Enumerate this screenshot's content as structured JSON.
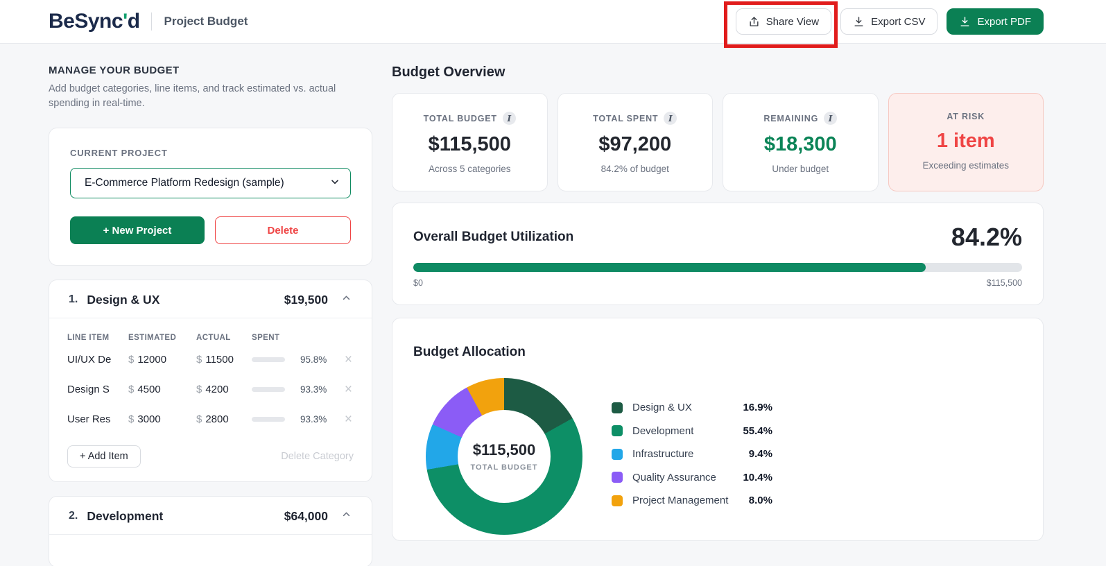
{
  "header": {
    "logo": {
      "pre": "BeSync",
      "apostrophe": "'",
      "post": "d"
    },
    "page_title": "Project Budget",
    "buttons": {
      "share": "Share View",
      "export_csv": "Export CSV",
      "export_pdf": "Export PDF"
    }
  },
  "sidebar": {
    "heading": "MANAGE YOUR BUDGET",
    "description": "Add budget categories, line items, and track estimated vs. actual spending in real-time.",
    "project": {
      "label": "CURRENT PROJECT",
      "selected": "E-Commerce Platform Redesign (sample)",
      "new_button": "+ New Project",
      "delete_button": "Delete"
    },
    "table_columns": {
      "line_item": "LINE ITEM",
      "estimated": "ESTIMATED",
      "actual": "ACTUAL",
      "spent": "SPENT"
    },
    "categories": [
      {
        "number": "1.",
        "name": "Design & UX",
        "total": "$19,500",
        "items": [
          {
            "name": "UI/UX De",
            "currency": "$",
            "estimated": "12000",
            "actual": "11500",
            "spent": "95.8%"
          },
          {
            "name": "Design S",
            "currency": "$",
            "estimated": "4500",
            "actual": "4200",
            "spent": "93.3%"
          },
          {
            "name": "User Res",
            "currency": "$",
            "estimated": "3000",
            "actual": "2800",
            "spent": "93.3%"
          }
        ],
        "add_item": "+ Add Item",
        "delete_category": "Delete Category",
        "close_glyph": "×"
      },
      {
        "number": "2.",
        "name": "Development",
        "total": "$64,000"
      }
    ]
  },
  "overview": {
    "title": "Budget Overview",
    "info_glyph": "I",
    "cards": [
      {
        "label": "TOTAL BUDGET",
        "value": "$115,500",
        "sub": "Across 5 categories"
      },
      {
        "label": "TOTAL SPENT",
        "value": "$97,200",
        "sub": "84.2% of budget"
      },
      {
        "label": "REMAINING",
        "value": "$18,300",
        "sub": "Under budget"
      },
      {
        "label": "AT RISK",
        "value": "1 item",
        "sub": "Exceeding estimates"
      }
    ],
    "utilization": {
      "title": "Overall Budget Utilization",
      "percent_label": "84.2%",
      "percent": 84.2,
      "min": "$0",
      "max": "$115,500"
    }
  },
  "chart_data": {
    "type": "pie",
    "donut": true,
    "title": "Budget Allocation",
    "center": {
      "value": "$115,500",
      "label": "TOTAL BUDGET"
    },
    "legend_position": "right",
    "series": [
      {
        "name": "Design & UX",
        "value": 16.9,
        "label": "16.9%",
        "color": "#1d5b44"
      },
      {
        "name": "Development",
        "value": 55.4,
        "label": "55.4%",
        "color": "#0d8f66"
      },
      {
        "name": "Infrastructure",
        "value": 9.4,
        "label": "9.4%",
        "color": "#22a7e8"
      },
      {
        "name": "Quality Assurance",
        "value": 10.4,
        "label": "10.4%",
        "color": "#8b5cf6"
      },
      {
        "name": "Project Management",
        "value": 8.0,
        "label": "8.0%",
        "color": "#f2a20d"
      }
    ]
  },
  "colors": {
    "primary_green": "#0b8054",
    "bar_green": "#0e8a63",
    "risk_red": "#ef4444",
    "annotation_red": "#e11c1c",
    "navy": "#1b2a4a"
  }
}
